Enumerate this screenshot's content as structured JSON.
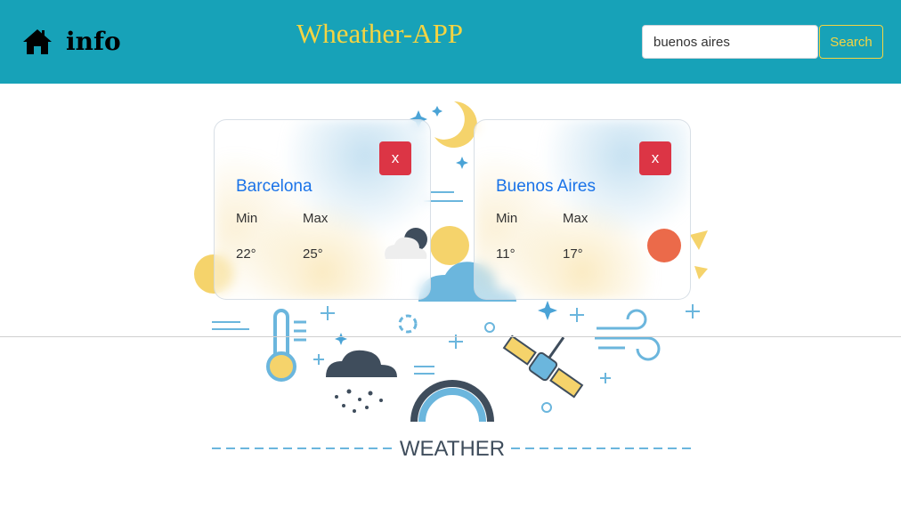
{
  "header": {
    "home_icon": "home-icon",
    "info_label": "info",
    "title": "Wheather-APP",
    "search_value": "buenos aires",
    "search_button": "Search",
    "bg_color": "#17a2b8",
    "accent_color": "#f5d442"
  },
  "background": {
    "caption": "WEATHER"
  },
  "cards": [
    {
      "city": "Barcelona",
      "close_label": "x",
      "min_label": "Min",
      "max_label": "Max",
      "min_value": "22°",
      "max_value": "25°",
      "icon": "partly-cloudy-night-icon"
    },
    {
      "city": "Buenos Aires",
      "close_label": "x",
      "min_label": "Min",
      "max_label": "Max",
      "min_value": "11°",
      "max_value": "17°",
      "icon": "sun-icon"
    }
  ]
}
